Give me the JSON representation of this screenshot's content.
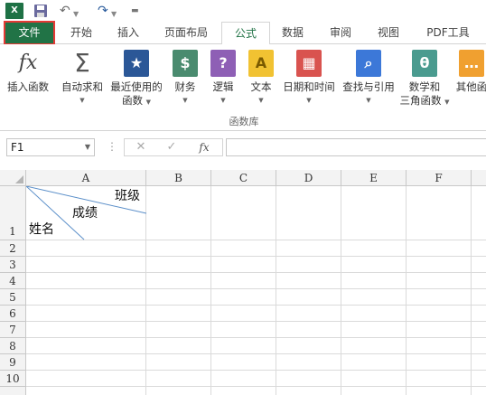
{
  "quick_access": {
    "excel_icon": "excel-icon",
    "save_icon": "save-icon",
    "undo_icon": "undo-icon",
    "redo_icon": "redo-icon",
    "customize_icon": "customize-qat-icon"
  },
  "tabs": {
    "file": "文件",
    "home": "开始",
    "insert": "插入",
    "page_layout": "页面布局",
    "formulas": "公式",
    "data": "数据",
    "review": "审阅",
    "view": "视图",
    "pdf_tools": "PDF工具"
  },
  "ribbon": {
    "insert_function": "插入函数",
    "autosum": "自动求和",
    "recent_line1": "最近使用的",
    "recent_line2": "函数",
    "financial": "财务",
    "logical": "逻辑",
    "text": "文本",
    "datetime": "日期和时间",
    "lookup": "查找与引用",
    "math_line1": "数学和",
    "math_line2": "三角函数",
    "other": "其他函",
    "group_label": "函数库",
    "icons": {
      "fx": "fx",
      "sigma": "Σ",
      "star": "★",
      "coins": "$",
      "question": "?",
      "text_a": "A",
      "calendar": "▦",
      "search": "⌕",
      "theta": "θ",
      "more": "…"
    },
    "colors": {
      "recent": "#2b5797",
      "financial": "#4a8b6f",
      "logical": "#8e5fb5",
      "text": "#f1c232",
      "datetime": "#d9534f",
      "lookup": "#3c78d8",
      "math": "#4a9b8f",
      "other": "#f0a030"
    }
  },
  "formula_bar": {
    "name_box": "F1",
    "cancel": "✕",
    "enter": "✓",
    "fx": "fx"
  },
  "grid": {
    "columns": [
      "A",
      "B",
      "C",
      "D",
      "E",
      "F"
    ],
    "rows": [
      "1",
      "2",
      "3",
      "4",
      "5",
      "6",
      "7",
      "8",
      "9",
      "10"
    ],
    "a1_text": {
      "class_label": "班级",
      "score_label": "成绩",
      "name_label": "姓名"
    }
  },
  "accent_colors": {
    "excel_green": "#217346",
    "highlight_red": "#e53935"
  }
}
